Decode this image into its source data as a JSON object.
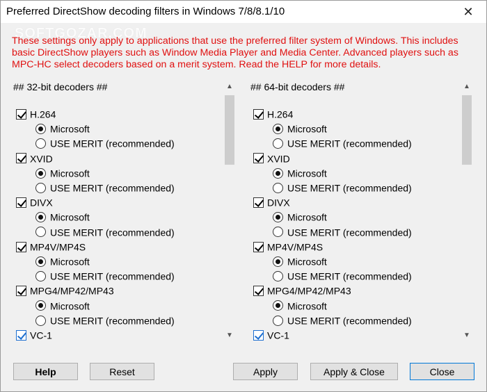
{
  "window": {
    "title": "Preferred DirectShow decoding filters in Windows 7/8/8.1/10",
    "close_glyph": "✕",
    "watermark": "SOFTGOZAR.COM"
  },
  "notice": "These settings only apply to applications that use the preferred filter system of Windows. This includes basic DirectShow players such as Window Media Player and Media Center. Advanced players such as MPC-HC select decoders based on a merit system. Read the HELP for more details.",
  "panes": [
    {
      "header": "##  32-bit decoders  ##",
      "codecs": [
        {
          "name": "H.264",
          "checked": true,
          "options": [
            "Microsoft",
            "USE MERIT  (recommended)"
          ],
          "selected": 0
        },
        {
          "name": "XVID",
          "checked": true,
          "options": [
            "Microsoft",
            "USE MERIT  (recommended)"
          ],
          "selected": 0
        },
        {
          "name": "DIVX",
          "checked": true,
          "options": [
            "Microsoft",
            "USE MERIT  (recommended)"
          ],
          "selected": 0
        },
        {
          "name": "MP4V/MP4S",
          "checked": true,
          "options": [
            "Microsoft",
            "USE MERIT  (recommended)"
          ],
          "selected": 0
        },
        {
          "name": "MPG4/MP42/MP43",
          "checked": true,
          "options": [
            "Microsoft",
            "USE MERIT  (recommended)"
          ],
          "selected": 0
        },
        {
          "name": "VC-1",
          "checked": true
        }
      ]
    },
    {
      "header": "##  64-bit decoders  ##",
      "codecs": [
        {
          "name": "H.264",
          "checked": true,
          "options": [
            "Microsoft",
            "USE MERIT  (recommended)"
          ],
          "selected": 0
        },
        {
          "name": "XVID",
          "checked": true,
          "options": [
            "Microsoft",
            "USE MERIT  (recommended)"
          ],
          "selected": 0
        },
        {
          "name": "DIVX",
          "checked": true,
          "options": [
            "Microsoft",
            "USE MERIT  (recommended)"
          ],
          "selected": 0
        },
        {
          "name": "MP4V/MP4S",
          "checked": true,
          "options": [
            "Microsoft",
            "USE MERIT  (recommended)"
          ],
          "selected": 0
        },
        {
          "name": "MPG4/MP42/MP43",
          "checked": true,
          "options": [
            "Microsoft",
            "USE MERIT  (recommended)"
          ],
          "selected": 0
        },
        {
          "name": "VC-1",
          "checked": true
        }
      ]
    }
  ],
  "buttons": {
    "help": "Help",
    "reset": "Reset",
    "apply": "Apply",
    "apply_close": "Apply & Close",
    "close": "Close"
  },
  "colors": {
    "notice": "#e01010",
    "focus_border": "#0078d7"
  }
}
